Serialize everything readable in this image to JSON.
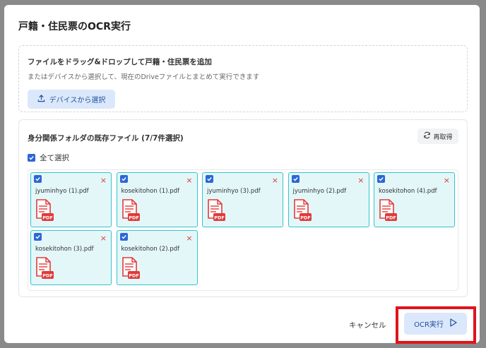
{
  "dialog": {
    "title": "戸籍・住民票のOCR実行"
  },
  "dropzone": {
    "title": "ファイルをドラッグ&ドロップして戸籍・住民票を追加",
    "subtitle": "またはデバイスから選択して、現在のDriveファイルとまとめて実行できます",
    "device_button_label": "デバイスから選択"
  },
  "existing_files": {
    "title": "身分関係フォルダの既存ファイル (7/7件選択)",
    "refresh_label": "再取得",
    "select_all_label": "全て選択",
    "files": [
      {
        "name": "jyuminhyo (1).pdf",
        "checked": true
      },
      {
        "name": "kosekitohon (1).pdf",
        "checked": true
      },
      {
        "name": "jyuminhyo (3).pdf",
        "checked": true
      },
      {
        "name": "jyuminhyo (2).pdf",
        "checked": true
      },
      {
        "name": "kosekitohon (4).pdf",
        "checked": true
      },
      {
        "name": "kosekitohon (3).pdf",
        "checked": true
      },
      {
        "name": "kosekitohon (2).pdf",
        "checked": true
      }
    ],
    "pdf_badge": "PDF",
    "remove_icon": "×"
  },
  "footer": {
    "cancel_label": "キャンセル",
    "ocr_label": "OCR実行"
  },
  "colors": {
    "accent": "#2b67d6",
    "button_bg": "#dbe8fb",
    "card_bg": "#e3f7f9",
    "card_border": "#38c3c9",
    "highlight": "#e0141b",
    "pdf_red": "#e03a3a"
  }
}
